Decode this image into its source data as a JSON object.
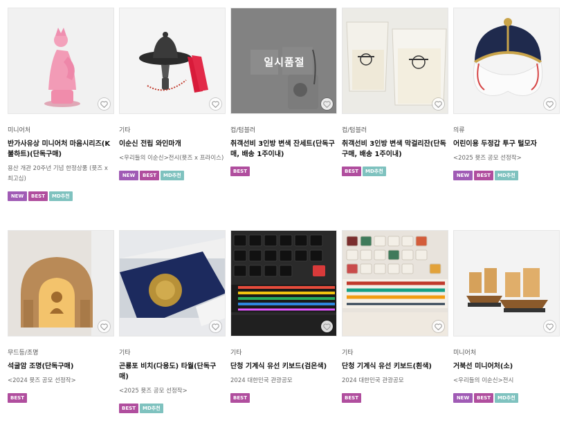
{
  "colors": {
    "new": "#a05bb5",
    "best": "#b04e9e",
    "md": "#7fc2bf",
    "heart": "#b5b5b5"
  },
  "products": [
    {
      "category": "미니어처",
      "title": "반가사유상 미니어처 마음시리즈(K 불하트)(단독구매)",
      "desc": "용산 개관 20주년 기념 한정상품 (뮷즈 x 최고심)",
      "badges": [
        "NEW",
        "BEST",
        "MD추천"
      ],
      "soldout": ""
    },
    {
      "category": "기타",
      "title": "이순신 전립 와인마개",
      "desc": "<우리들의 이순신>전시(뮷즈 x 프라이스)",
      "badges": [
        "NEW",
        "BEST",
        "MD추천"
      ],
      "soldout": ""
    },
    {
      "category": "컵/텀블러",
      "title": "취객선비 3인방 변색 잔세트(단독구매, 배송 1주이내)",
      "desc": "",
      "badges": [
        "BEST"
      ],
      "soldout": "일시품절"
    },
    {
      "category": "컵/텀블러",
      "title": "취객선비 3인방 변색 막걸리잔(단독구매, 배송 1주이내)",
      "desc": "",
      "badges": [
        "BEST",
        "MD추천"
      ],
      "soldout": ""
    },
    {
      "category": "의류",
      "title": "어린이용 두정갑 투구 털모자",
      "desc": "<2025 뮷즈 공모 선정작>",
      "badges": [
        "NEW",
        "BEST",
        "MD추천"
      ],
      "soldout": ""
    },
    {
      "category": "무드등/조명",
      "title": "석굴암 조명(단독구매)",
      "desc": "<2024 뮷즈 공모 선정작>",
      "badges": [
        "BEST"
      ],
      "soldout": ""
    },
    {
      "category": "기타",
      "title": "곤룡포 비치(다용도) 타월(단독구매)",
      "desc": "<2025 뮷즈 공모 선정작>",
      "badges": [
        "BEST",
        "MD추천"
      ],
      "soldout": ""
    },
    {
      "category": "기타",
      "title": "단청 기계식 유선 키보드(검은색)",
      "desc": "2024 대한민국 관광공모",
      "badges": [
        "BEST"
      ],
      "soldout": ""
    },
    {
      "category": "기타",
      "title": "단청 기계식 유선 키보드(흰색)",
      "desc": "2024 대한민국 관광공모",
      "badges": [
        "BEST"
      ],
      "soldout": ""
    },
    {
      "category": "미니어처",
      "title": "거북선 미니어처(소)",
      "desc": "<우리들의 이순신>전시",
      "badges": [
        "NEW",
        "BEST",
        "MD추천"
      ],
      "soldout": ""
    }
  ]
}
